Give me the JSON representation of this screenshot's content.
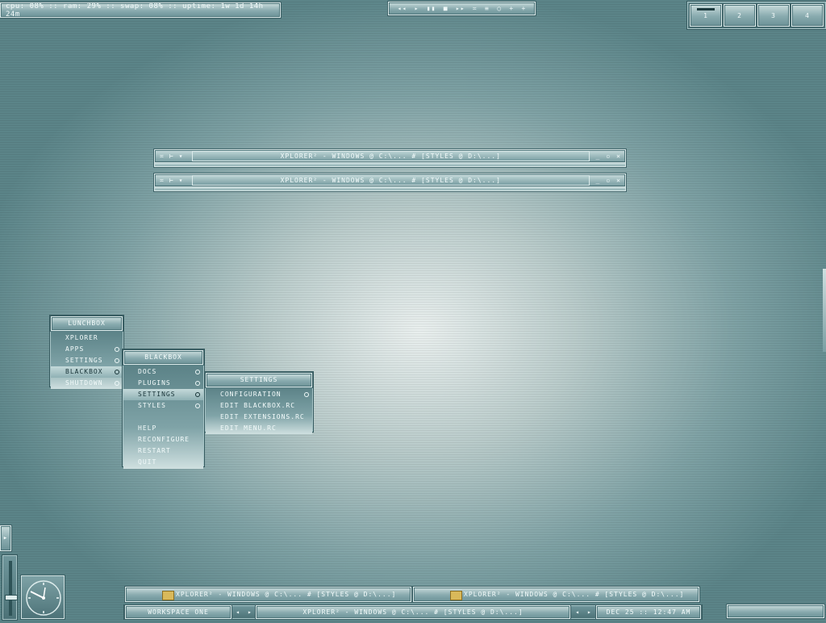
{
  "sysmon": {
    "text": "cpu: 08% :: ram: 29% :: swap: 08% :: uptime: 1w 1d 14h 24m"
  },
  "media": {
    "controls": [
      "◂◂",
      "▸",
      "▮▮",
      "■",
      "▸▸",
      "≍",
      "≡",
      "○",
      "+",
      "+"
    ]
  },
  "pager": {
    "workspaces": [
      "1",
      "2",
      "3",
      "4"
    ],
    "active": "1"
  },
  "windows": [
    {
      "title": "xplorer² - windows @ c:\\... # [styles @ d:\\...]",
      "left_buttons": [
        "≍",
        "⊢",
        "▾"
      ],
      "right_buttons": [
        "_",
        "▫",
        "✕"
      ]
    },
    {
      "title": "xplorer² - windows @ c:\\... # [styles @ d:\\...]",
      "left_buttons": [
        "≍",
        "⊢",
        "▾"
      ],
      "right_buttons": [
        "_",
        "▫",
        "✕"
      ]
    }
  ],
  "menus": {
    "lunchbox": {
      "title": "LUNCHBOX",
      "items": [
        {
          "label": "XPLORER",
          "submenu": false
        },
        {
          "label": "APPS",
          "submenu": true
        },
        {
          "label": "SETTINGS",
          "submenu": true
        },
        {
          "label": "BLACKBOX",
          "submenu": true,
          "highlighted": true
        },
        {
          "label": "SHUTDOWN",
          "submenu": true
        }
      ]
    },
    "blackbox": {
      "title": "BLACKBOX",
      "items": [
        {
          "label": "DOCS",
          "submenu": true
        },
        {
          "label": "PLUGINS",
          "submenu": true
        },
        {
          "label": "SETTINGS",
          "submenu": true,
          "highlighted": true
        },
        {
          "label": "STYLES",
          "submenu": true
        }
      ],
      "items2": [
        {
          "label": "HELP"
        },
        {
          "label": "RECONFIGURE"
        },
        {
          "label": "RESTART"
        },
        {
          "label": "QUIT"
        }
      ]
    },
    "settings": {
      "title": "SETTINGS",
      "items": [
        {
          "label": "CONFIGURATION",
          "submenu": true
        },
        {
          "label": "EDIT BLACKBOX.RC",
          "submenu": false
        },
        {
          "label": "EDIT EXTENSIONS.RC",
          "submenu": false
        },
        {
          "label": "EDIT MENU.RC",
          "submenu": false
        }
      ]
    }
  },
  "taskbar": {
    "tasks": [
      "xplorer² - windows @ c:\\... # [styles @ d:\\...]",
      "xplorer² - windows @ c:\\... # [styles @ d:\\...]"
    ],
    "workspace": "WORKSPACE ONE",
    "nav_prev": "◂",
    "nav_next": "▸",
    "current_window": "xplorer² - windows @ c:\\... # [styles @ d:\\...]",
    "clock": "DEC 25 :: 12:47 AM"
  },
  "colors": {
    "accent": "#6c9297",
    "highlight": "#c4d9da",
    "text": "#f3fbfb"
  }
}
